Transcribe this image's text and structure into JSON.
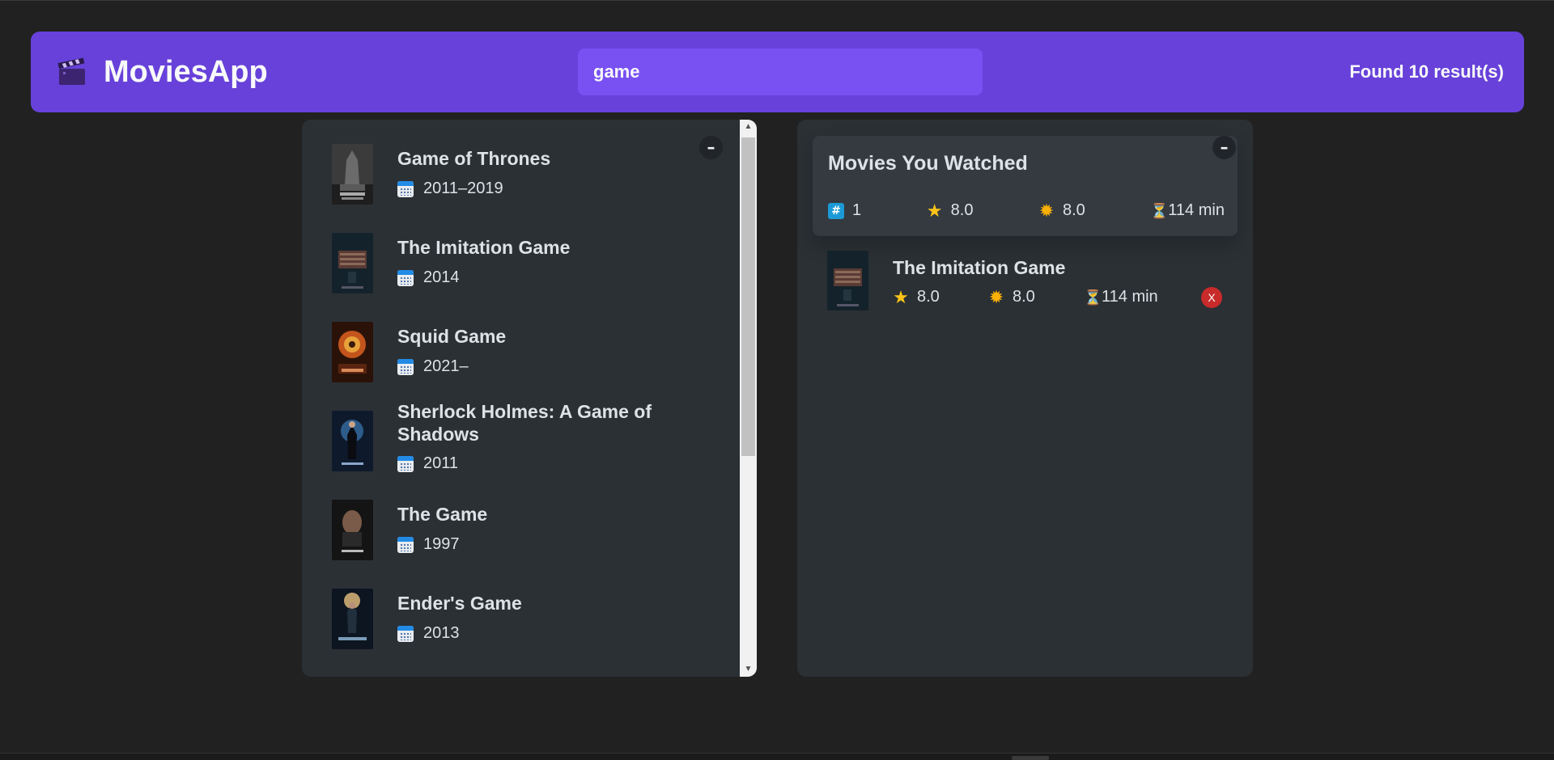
{
  "navbar": {
    "logo_icon": "clapperboard-icon",
    "title": "MoviesApp",
    "search_value": "game",
    "search_placeholder": "Search movies...",
    "results_text": "Found 10 result(s)",
    "accent_color": "#6741d9"
  },
  "search_list": {
    "toggle_label": "–",
    "movies": [
      {
        "title": "Game of Thrones",
        "year": "2011–2019"
      },
      {
        "title": "The Imitation Game",
        "year": "2014"
      },
      {
        "title": "Squid Game",
        "year": "2021–"
      },
      {
        "title": "Sherlock Holmes: A Game of Shadows",
        "year": "2011"
      },
      {
        "title": "The Game",
        "year": "1997"
      },
      {
        "title": "Ender's Game",
        "year": "2013"
      }
    ]
  },
  "watched": {
    "toggle_label": "–",
    "summary": {
      "heading": "Movies You Watched",
      "count": "1",
      "avg_imdb_rating": "8.0",
      "avg_user_rating": "8.0",
      "avg_runtime": "114 min"
    },
    "items": [
      {
        "title": "The Imitation Game",
        "imdb_rating": "8.0",
        "user_rating": "8.0",
        "runtime": "114 min",
        "delete_label": "X"
      }
    ]
  }
}
